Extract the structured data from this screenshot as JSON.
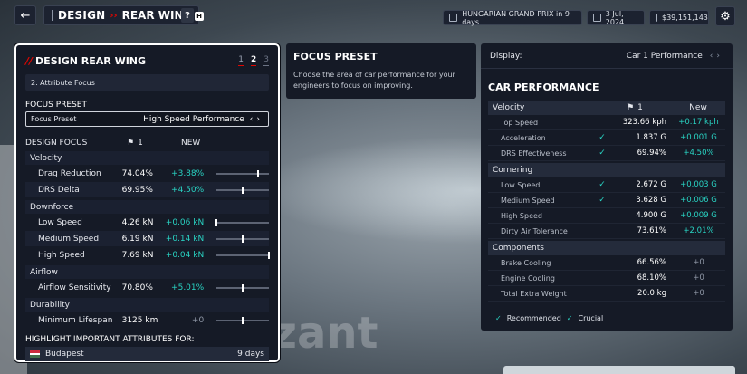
{
  "header": {
    "back_icon": "arrow-left-icon",
    "title_part1": "DESIGN",
    "title_part2": "REAR WING",
    "help_label": "?",
    "help_key": "H",
    "event": "HUNGARIAN GRAND PRIX in 9 days",
    "date": "3 Jul, 2024",
    "balance": "$39,151,143",
    "settings_icon": "gear-icon"
  },
  "left_panel": {
    "title": "DESIGN REAR WING",
    "steps": [
      "1",
      "2",
      "3"
    ],
    "current_step": "2",
    "attribute_focus": "2. Attribute Focus",
    "focus_preset_label": "FOCUS PRESET",
    "focus_preset_field": "Focus Preset",
    "focus_preset_value": "High Speed Performance",
    "design_focus_label": "DESIGN FOCUS",
    "driver_col": "1",
    "new_col": "NEW",
    "groups": [
      {
        "name": "Velocity",
        "rows": [
          {
            "name": "Drag Reduction",
            "value": "74.04%",
            "new": "+3.88%",
            "slider": 0.8
          },
          {
            "name": "DRS Delta",
            "value": "69.95%",
            "new": "+4.50%",
            "slider": 0.5
          }
        ]
      },
      {
        "name": "Downforce",
        "rows": [
          {
            "name": "Low Speed",
            "value": "4.26 kN",
            "new": "+0.06 kN",
            "slider": 0.0
          },
          {
            "name": "Medium Speed",
            "value": "6.19 kN",
            "new": "+0.14 kN",
            "slider": 0.5
          },
          {
            "name": "High Speed",
            "value": "7.69 kN",
            "new": "+0.04 kN",
            "slider": 1.0
          }
        ]
      },
      {
        "name": "Airflow",
        "rows": [
          {
            "name": "Airflow Sensitivity",
            "value": "70.80%",
            "new": "+5.01%",
            "slider": 0.5
          }
        ]
      },
      {
        "name": "Durability",
        "rows": [
          {
            "name": "Minimum Lifespan",
            "value": "3125 km",
            "new": "+0",
            "slider": 0.5
          }
        ]
      }
    ],
    "highlight_label": "HIGHLIGHT IMPORTANT ATTRIBUTES FOR:",
    "highlight_track": "Budapest",
    "highlight_days": "9 days"
  },
  "focus_panel": {
    "title": "FOCUS PRESET",
    "desc": "Choose the area of car performance for your engineers to focus on improving."
  },
  "car_panel": {
    "display_label": "Display:",
    "display_value": "Car 1 Performance",
    "title": "CAR PERFORMANCE",
    "driver_col": "1",
    "new_col": "New",
    "groups": [
      {
        "name": "Velocity",
        "rows": [
          {
            "name": "Top Speed",
            "check": "",
            "value": "323.66 kph",
            "new": "+0.17 kph"
          },
          {
            "name": "Acceleration",
            "check": "✓",
            "value": "1.837 G",
            "new": "+0.001 G"
          },
          {
            "name": "DRS Effectiveness",
            "check": "✓",
            "value": "69.94%",
            "new": "+4.50%"
          }
        ]
      },
      {
        "name": "Cornering",
        "rows": [
          {
            "name": "Low Speed",
            "check": "✓",
            "value": "2.672 G",
            "new": "+0.003 G"
          },
          {
            "name": "Medium Speed",
            "check": "✓",
            "value": "3.628 G",
            "new": "+0.006 G"
          },
          {
            "name": "High Speed",
            "check": "",
            "value": "4.900 G",
            "new": "+0.009 G"
          },
          {
            "name": "Dirty Air Tolerance",
            "check": "",
            "value": "73.61%",
            "new": "+2.01%"
          }
        ]
      },
      {
        "name": "Components",
        "rows": [
          {
            "name": "Brake Cooling",
            "check": "",
            "value": "66.56%",
            "new": "+0"
          },
          {
            "name": "Engine Cooling",
            "check": "",
            "value": "68.10%",
            "new": "+0"
          },
          {
            "name": "Total Extra Weight",
            "check": "",
            "value": "20.0 kg",
            "new": "+0"
          }
        ]
      }
    ],
    "legend_recommended": "Recommended",
    "legend_crucial": "Crucial"
  },
  "background_text": "zant"
}
